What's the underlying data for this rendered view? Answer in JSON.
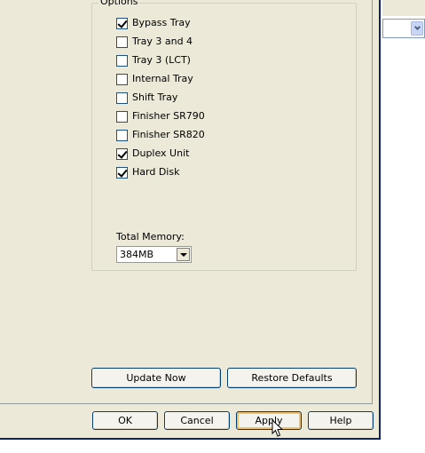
{
  "options_group": {
    "legend": "Options",
    "items": [
      {
        "label": "Bypass Tray",
        "checked": true
      },
      {
        "label": "Tray 3 and 4",
        "checked": false
      },
      {
        "label": "Tray 3 (LCT)",
        "checked": false
      },
      {
        "label": "Internal Tray",
        "checked": false
      },
      {
        "label": "Shift Tray",
        "checked": false
      },
      {
        "label": "Finisher SR790",
        "checked": false
      },
      {
        "label": "Finisher SR820",
        "checked": false
      },
      {
        "label": "Duplex Unit",
        "checked": true
      },
      {
        "label": "Hard Disk",
        "checked": true
      }
    ],
    "total_memory_label": "Total Memory:",
    "total_memory_value": "384MB"
  },
  "actions": {
    "update_now": "Update Now",
    "restore_defaults": "Restore Defaults"
  },
  "footer": {
    "ok": "OK",
    "cancel": "Cancel",
    "apply": "Apply",
    "help": "Help"
  },
  "icons": {
    "checkbox_checked": "check-mark-icon",
    "dropdown": "chevron-down-icon",
    "cursor": "mouse-pointer-icon"
  }
}
